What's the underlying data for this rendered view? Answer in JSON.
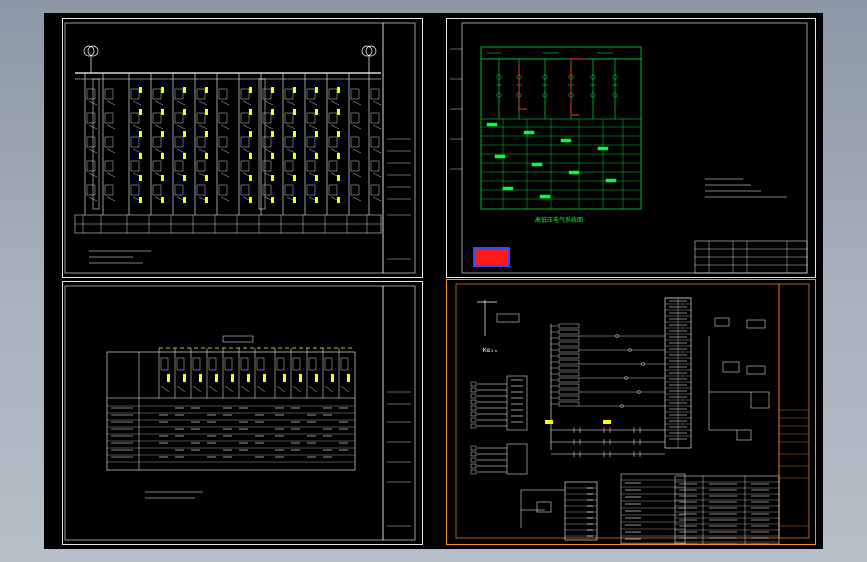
{
  "drawing": {
    "sheets": [
      {
        "id": "sheet-1",
        "kind": "low-voltage-switchgear-system",
        "active": false
      },
      {
        "id": "sheet-2",
        "kind": "high-voltage-distribution-system",
        "active": false,
        "title": "高低压电气系统图"
      },
      {
        "id": "sheet-3",
        "kind": "distribution-panel-schedule",
        "active": false
      },
      {
        "id": "sheet-4",
        "kind": "control-wiring-diagram",
        "active": true,
        "label": "Kα₁ₐ"
      }
    ]
  },
  "colors": {
    "canvas": "#000000",
    "frame": "#e8e8e8",
    "active_frame": "#ff8a1e",
    "wire": "#ffffff",
    "highlight": "#ffff00",
    "green": "#00ff3c",
    "red": "#ff3030",
    "cyan": "#35e0ff",
    "stamp_fill": "#ff1a1a",
    "stamp_border": "#2a4bff"
  }
}
